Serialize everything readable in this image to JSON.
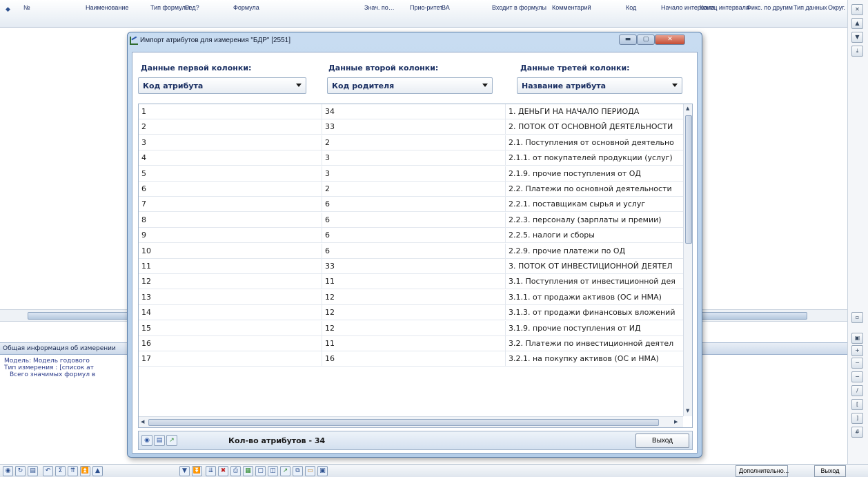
{
  "main": {
    "columns": [
      "№",
      "Наименование",
      "Тип формулы",
      "Ред?",
      "Формула",
      "Знач. по…",
      "Прио-ритет",
      "ВА",
      "Входит в формулы",
      "Комментарий",
      "Код",
      "Начало интервала",
      "Конец интервала",
      "Фикс. по другим",
      "Тип данных",
      "Округ."
    ],
    "info_header": "Общая информация об измерении",
    "info_lines": [
      "Модель: Модель годового",
      "Тип измерения : [список ат",
      "Всего значимых формул в"
    ],
    "bottom_buttons": {
      "more": "Дополнительно...",
      "exit": "Выход"
    }
  },
  "dialog": {
    "title": "Импорт атрибутов для измерения \"БДР\" [2551]",
    "col1_label": "Данные первой колонки:",
    "col2_label": "Данные второй колонки:",
    "col3_label": "Данные третей колонки:",
    "col1_value": "Код атрибута",
    "col2_value": "Код родителя",
    "col3_value": "Название атрибута",
    "rows": [
      {
        "a": "1",
        "b": "34",
        "c": "1. ДЕНЬГИ НА НАЧАЛО ПЕРИОДА"
      },
      {
        "a": "2",
        "b": "33",
        "c": "2. ПОТОК ОТ ОСНОВНОЙ ДЕЯТЕЛЬНОСТИ"
      },
      {
        "a": "3",
        "b": "2",
        "c": "2.1. Поступления от основной деятельно"
      },
      {
        "a": "4",
        "b": "3",
        "c": "2.1.1. от покупателей продукции (услуг)"
      },
      {
        "a": "5",
        "b": "3",
        "c": "2.1.9. прочие поступления от ОД"
      },
      {
        "a": "6",
        "b": "2",
        "c": "2.2. Платежи по основной деятельности"
      },
      {
        "a": "7",
        "b": "6",
        "c": "2.2.1. поставщикам сырья и услуг"
      },
      {
        "a": "8",
        "b": "6",
        "c": "2.2.3. персоналу (зарплаты и премии)"
      },
      {
        "a": "9",
        "b": "6",
        "c": "2.2.5. налоги и сборы"
      },
      {
        "a": "10",
        "b": "6",
        "c": "2.2.9. прочие платежи по ОД"
      },
      {
        "a": "11",
        "b": "33",
        "c": "3. ПОТОК ОТ ИНВЕСТИЦИОННОЙ ДЕЯТЕЛ"
      },
      {
        "a": "12",
        "b": "11",
        "c": "3.1. Поступления от инвестиционной дея"
      },
      {
        "a": "13",
        "b": "12",
        "c": "3.1.1. от продажи активов (ОС и НМА)"
      },
      {
        "a": "14",
        "b": "12",
        "c": "3.1.3. от продажи финансовых вложений"
      },
      {
        "a": "15",
        "b": "12",
        "c": "3.1.9. прочие поступления от ИД"
      },
      {
        "a": "16",
        "b": "11",
        "c": "3.2. Платежи по инвестиционной деятел"
      },
      {
        "a": "17",
        "b": "16",
        "c": "3.2.1. на покупку активов (ОС и НМА)"
      }
    ],
    "count_label": "Кол-во атрибутов - 34",
    "exit_label": "Выход"
  }
}
